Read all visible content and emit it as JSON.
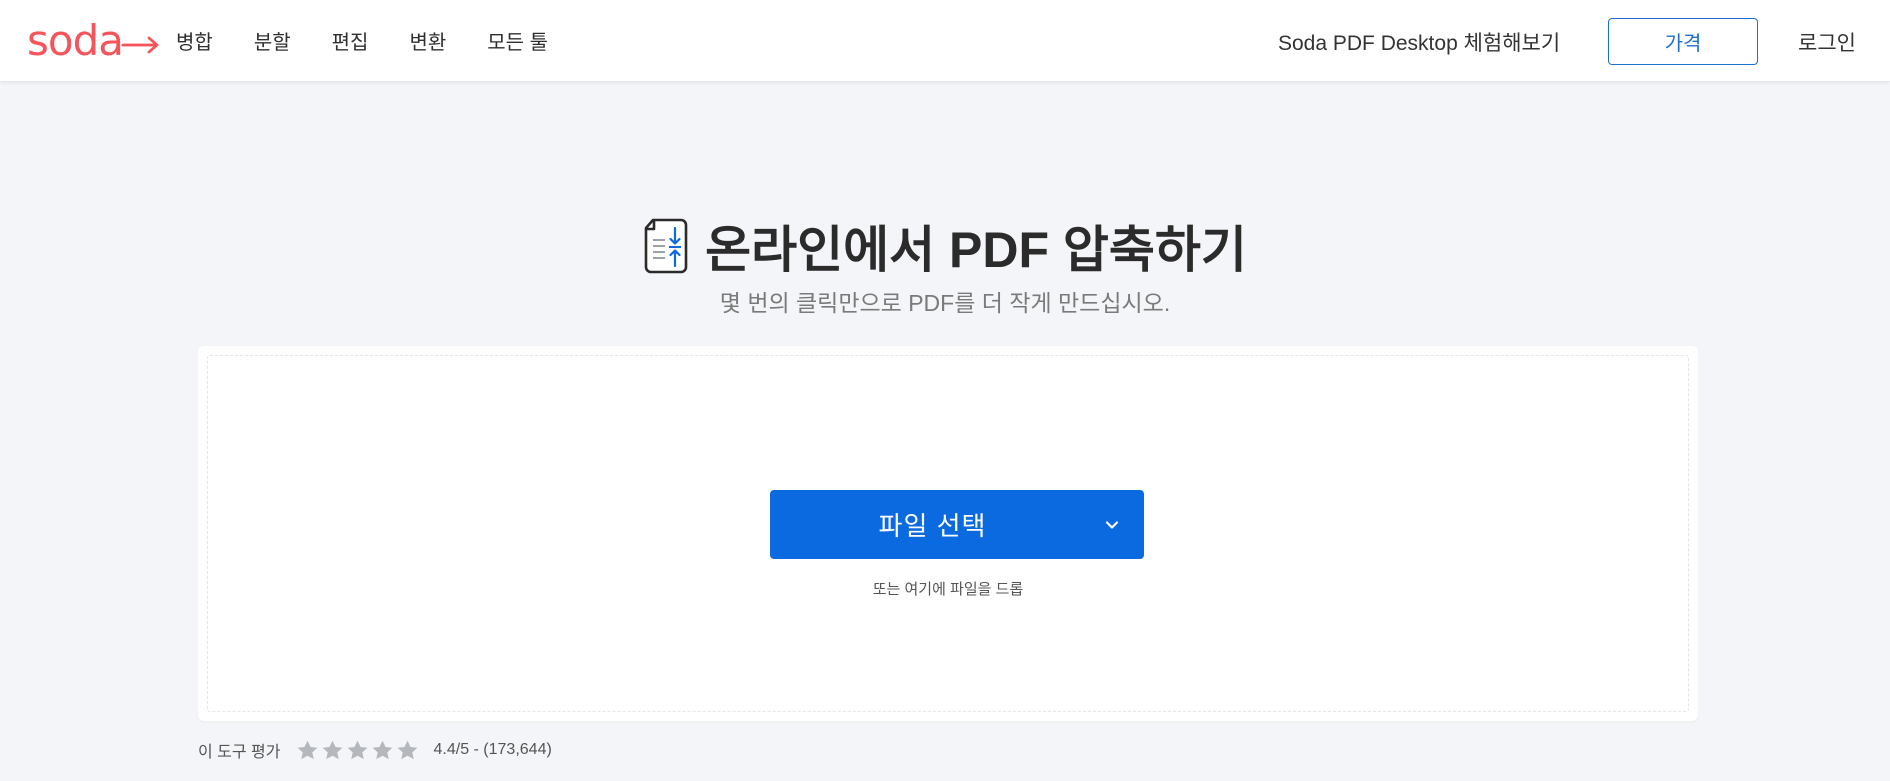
{
  "header": {
    "logo": {
      "text": "soda",
      "color": "#f4545a"
    },
    "nav": [
      {
        "label": "병합"
      },
      {
        "label": "분할"
      },
      {
        "label": "편집"
      },
      {
        "label": "변환"
      },
      {
        "label": "모든 툴"
      }
    ],
    "desktop_link": "Soda PDF Desktop 체험해보기",
    "price_button": "가격",
    "login": "로그인"
  },
  "hero": {
    "icon": "compress-pdf-icon",
    "title": "온라인에서 PDF 압축하기",
    "subtitle": "몇 번의 클릭만으로 PDF를 더 작게 만드십시오."
  },
  "upload": {
    "button_label": "파일 선택",
    "dropdown_icon": "chevron-down-icon",
    "drop_hint": "또는 여기에 파일을 드롭",
    "accent_color": "#0b6ae0"
  },
  "rating": {
    "label": "이 도구 평가",
    "stars_total": 5,
    "score_text": "4.4/5 - (173,644)"
  }
}
